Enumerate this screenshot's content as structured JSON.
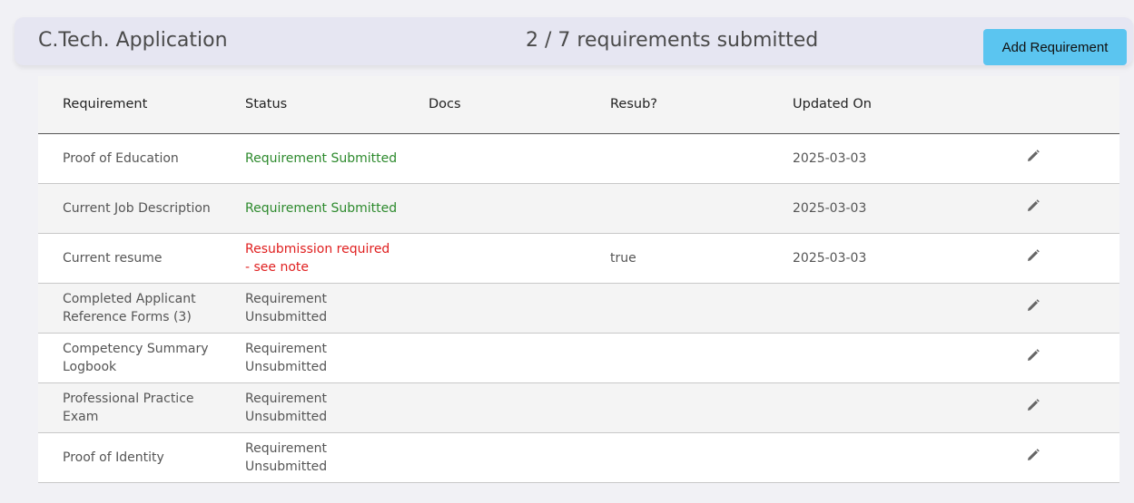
{
  "header": {
    "title": "C.Tech. Application",
    "progress": "2 / 7 requirements submitted",
    "add_button_label": "Add Requirement"
  },
  "table": {
    "columns": [
      "Requirement",
      "Status",
      "Docs",
      "Resub?",
      "Updated On",
      ""
    ],
    "rows": [
      {
        "requirement": "Proof of Education",
        "status": "Requirement Submitted",
        "docs": "",
        "resub": "",
        "updated": "2025-03-03",
        "edit_icon": "pencil-icon"
      },
      {
        "requirement": "Current Job Description",
        "status": "Requirement Submitted",
        "docs": "",
        "resub": "",
        "updated": "2025-03-03",
        "edit_icon": "pencil-icon"
      },
      {
        "requirement": "Current resume",
        "status": "Resubmission required - see note",
        "docs": "",
        "resub": "true",
        "updated": "2025-03-03",
        "edit_icon": "pencil-icon"
      },
      {
        "requirement": "Completed Applicant Reference Forms (3)",
        "status": "Requirement Unsubmitted",
        "docs": "",
        "resub": "",
        "updated": "",
        "edit_icon": "pencil-icon"
      },
      {
        "requirement": "Competency Summary Logbook",
        "status": "Requirement Unsubmitted",
        "docs": "",
        "resub": "",
        "updated": "",
        "edit_icon": "pencil-icon"
      },
      {
        "requirement": "Professional Practice Exam",
        "status": "Requirement Unsubmitted",
        "docs": "",
        "resub": "",
        "updated": "",
        "edit_icon": "pencil-icon"
      },
      {
        "requirement": "Proof of Identity",
        "status": "Requirement Unsubmitted",
        "docs": "",
        "resub": "",
        "updated": "",
        "edit_icon": "pencil-icon"
      }
    ]
  },
  "colors": {
    "submitted": "#2d8a2d",
    "resubmission": "#e02020",
    "accent_button": "#5bc5f0"
  }
}
